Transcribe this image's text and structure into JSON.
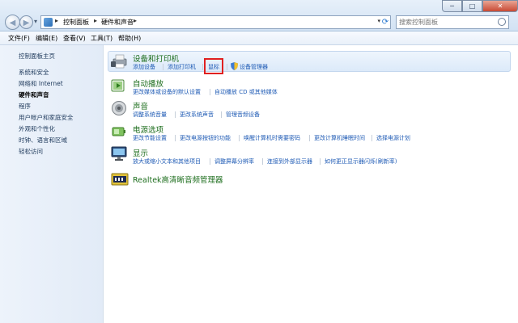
{
  "window": {
    "breadcrumbs": [
      "控制面板",
      "硬件和声音"
    ],
    "search_placeholder": "搜索控制面板",
    "buttons": {
      "minimize": "─",
      "maximize": "□",
      "close": "✕"
    }
  },
  "menu": [
    "文件(F)",
    "编辑(E)",
    "查看(V)",
    "工具(T)",
    "帮助(H)"
  ],
  "sidebar": {
    "items": [
      {
        "label": "控制面板主页",
        "current": false
      },
      {
        "label": "系统和安全",
        "current": false
      },
      {
        "label": "网络和 Internet",
        "current": false
      },
      {
        "label": "硬件和声音",
        "current": true
      },
      {
        "label": "程序",
        "current": false
      },
      {
        "label": "用户帐户和家庭安全",
        "current": false
      },
      {
        "label": "外观和个性化",
        "current": false
      },
      {
        "label": "时钟、语言和区域",
        "current": false
      },
      {
        "label": "轻松访问",
        "current": false
      }
    ]
  },
  "categories": [
    {
      "title": "设备和打印机",
      "icon": "printer-icon",
      "links": [
        "添加设备",
        "添加打印机",
        "鼠标",
        "设备管理器"
      ],
      "highlighted_link": "鼠标"
    },
    {
      "title": "自动播放",
      "icon": "autoplay-icon",
      "links": [
        "更改媒体或设备的默认设置",
        "自动播放 CD 或其他媒体"
      ]
    },
    {
      "title": "声音",
      "icon": "sound-icon",
      "links": [
        "调整系统音量",
        "更改系统声音",
        "管理音频设备"
      ]
    },
    {
      "title": "电源选项",
      "icon": "power-icon",
      "links": [
        "更改节能设置",
        "更改电源按钮的功能",
        "唤醒计算机时需要密码",
        "更改计算机睡眠时间",
        "选择电源计划"
      ]
    },
    {
      "title": "显示",
      "icon": "display-icon",
      "links": [
        "放大或缩小文本和其他项目",
        "调整屏幕分辨率",
        "连接到外部显示器",
        "如何更正显示器闪烁(刷新率)"
      ]
    },
    {
      "title": "Realtek高清晰音频管理器",
      "icon": "realtek-icon",
      "links": []
    }
  ],
  "colors": {
    "link": "#1f5bb5",
    "category_title": "#1e6e1e",
    "highlight_border": "#e02020",
    "sidebar_bg": "#e6eef9"
  }
}
